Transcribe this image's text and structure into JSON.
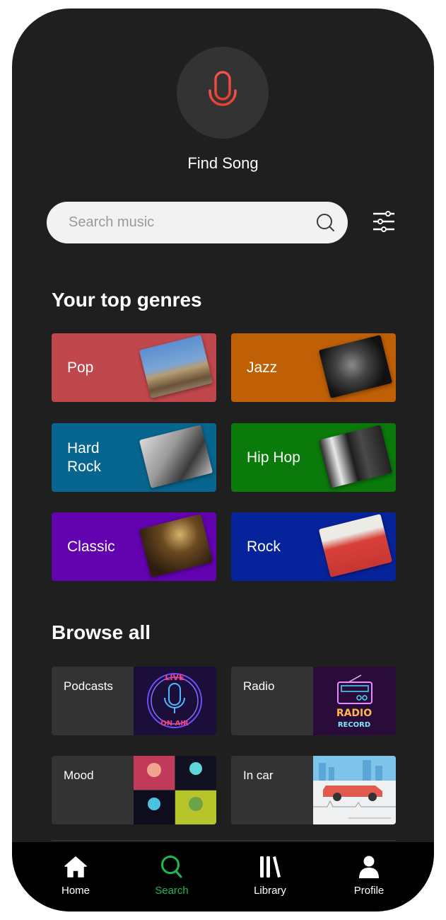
{
  "voice": {
    "icon": "microphone-icon",
    "label": "Find Song",
    "icon_color": "#f04a3a"
  },
  "search": {
    "placeholder": "Search music",
    "value": "",
    "icon": "search-icon",
    "filter_icon": "sliders-icon"
  },
  "top_genres": {
    "title": "Your top genres",
    "items": [
      {
        "label": "Pop",
        "color": "#c0484c",
        "image": "band-photo"
      },
      {
        "label": "Jazz",
        "color": "#bf5f06",
        "image": "jazz-musician-photo"
      },
      {
        "label": "Hard Rock",
        "color": "#07668f",
        "image": "rock-band-photo"
      },
      {
        "label": "Hip Hop",
        "color": "#0a7a0a",
        "image": "hiphop-group-photo"
      },
      {
        "label": "Classic",
        "color": "#6303b0",
        "image": "classical-painting"
      },
      {
        "label": "Rock",
        "color": "#07239b",
        "image": "rock-band-red-photo"
      }
    ]
  },
  "browse_all": {
    "title": "Browse all",
    "items": [
      {
        "label": "Podcasts",
        "image": "live-on-air-neon"
      },
      {
        "label": "Radio",
        "image": "radio-record-neon"
      },
      {
        "label": "Mood",
        "image": "mood-collage"
      },
      {
        "label": "In car",
        "image": "car-illustration"
      }
    ]
  },
  "bottom_nav": {
    "active_color": "#1db954",
    "items": [
      {
        "label": "Home",
        "icon": "home-icon",
        "active": false
      },
      {
        "label": "Search",
        "icon": "search-icon",
        "active": true
      },
      {
        "label": "Library",
        "icon": "library-icon",
        "active": false
      },
      {
        "label": "Profile",
        "icon": "profile-icon",
        "active": false
      }
    ]
  }
}
